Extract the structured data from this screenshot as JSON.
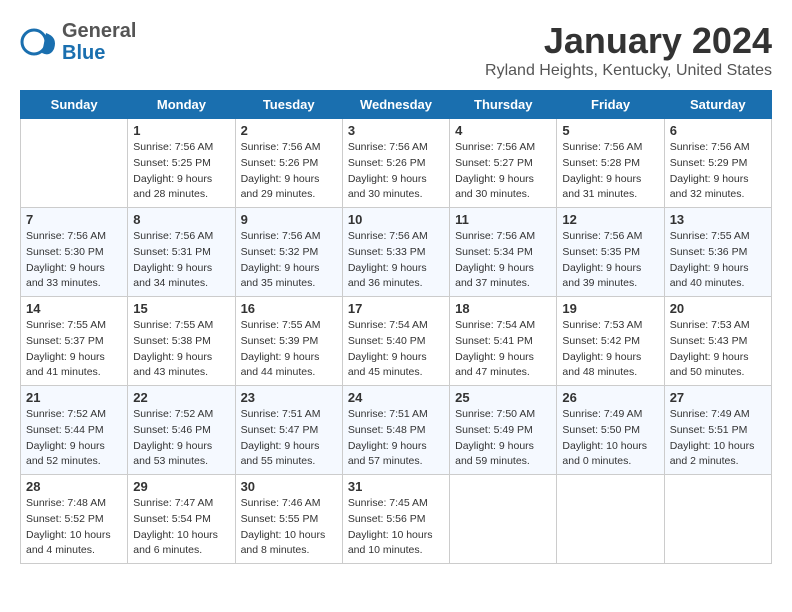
{
  "header": {
    "logo_line1": "General",
    "logo_line2": "Blue",
    "month_year": "January 2024",
    "location": "Ryland Heights, Kentucky, United States"
  },
  "days_of_week": [
    "Sunday",
    "Monday",
    "Tuesday",
    "Wednesday",
    "Thursday",
    "Friday",
    "Saturday"
  ],
  "weeks": [
    [
      {
        "day": "",
        "sunrise": "",
        "sunset": "",
        "daylight": ""
      },
      {
        "day": "1",
        "sunrise": "Sunrise: 7:56 AM",
        "sunset": "Sunset: 5:25 PM",
        "daylight": "Daylight: 9 hours and 28 minutes."
      },
      {
        "day": "2",
        "sunrise": "Sunrise: 7:56 AM",
        "sunset": "Sunset: 5:26 PM",
        "daylight": "Daylight: 9 hours and 29 minutes."
      },
      {
        "day": "3",
        "sunrise": "Sunrise: 7:56 AM",
        "sunset": "Sunset: 5:26 PM",
        "daylight": "Daylight: 9 hours and 30 minutes."
      },
      {
        "day": "4",
        "sunrise": "Sunrise: 7:56 AM",
        "sunset": "Sunset: 5:27 PM",
        "daylight": "Daylight: 9 hours and 30 minutes."
      },
      {
        "day": "5",
        "sunrise": "Sunrise: 7:56 AM",
        "sunset": "Sunset: 5:28 PM",
        "daylight": "Daylight: 9 hours and 31 minutes."
      },
      {
        "day": "6",
        "sunrise": "Sunrise: 7:56 AM",
        "sunset": "Sunset: 5:29 PM",
        "daylight": "Daylight: 9 hours and 32 minutes."
      }
    ],
    [
      {
        "day": "7",
        "sunrise": "Sunrise: 7:56 AM",
        "sunset": "Sunset: 5:30 PM",
        "daylight": "Daylight: 9 hours and 33 minutes."
      },
      {
        "day": "8",
        "sunrise": "Sunrise: 7:56 AM",
        "sunset": "Sunset: 5:31 PM",
        "daylight": "Daylight: 9 hours and 34 minutes."
      },
      {
        "day": "9",
        "sunrise": "Sunrise: 7:56 AM",
        "sunset": "Sunset: 5:32 PM",
        "daylight": "Daylight: 9 hours and 35 minutes."
      },
      {
        "day": "10",
        "sunrise": "Sunrise: 7:56 AM",
        "sunset": "Sunset: 5:33 PM",
        "daylight": "Daylight: 9 hours and 36 minutes."
      },
      {
        "day": "11",
        "sunrise": "Sunrise: 7:56 AM",
        "sunset": "Sunset: 5:34 PM",
        "daylight": "Daylight: 9 hours and 37 minutes."
      },
      {
        "day": "12",
        "sunrise": "Sunrise: 7:56 AM",
        "sunset": "Sunset: 5:35 PM",
        "daylight": "Daylight: 9 hours and 39 minutes."
      },
      {
        "day": "13",
        "sunrise": "Sunrise: 7:55 AM",
        "sunset": "Sunset: 5:36 PM",
        "daylight": "Daylight: 9 hours and 40 minutes."
      }
    ],
    [
      {
        "day": "14",
        "sunrise": "Sunrise: 7:55 AM",
        "sunset": "Sunset: 5:37 PM",
        "daylight": "Daylight: 9 hours and 41 minutes."
      },
      {
        "day": "15",
        "sunrise": "Sunrise: 7:55 AM",
        "sunset": "Sunset: 5:38 PM",
        "daylight": "Daylight: 9 hours and 43 minutes."
      },
      {
        "day": "16",
        "sunrise": "Sunrise: 7:55 AM",
        "sunset": "Sunset: 5:39 PM",
        "daylight": "Daylight: 9 hours and 44 minutes."
      },
      {
        "day": "17",
        "sunrise": "Sunrise: 7:54 AM",
        "sunset": "Sunset: 5:40 PM",
        "daylight": "Daylight: 9 hours and 45 minutes."
      },
      {
        "day": "18",
        "sunrise": "Sunrise: 7:54 AM",
        "sunset": "Sunset: 5:41 PM",
        "daylight": "Daylight: 9 hours and 47 minutes."
      },
      {
        "day": "19",
        "sunrise": "Sunrise: 7:53 AM",
        "sunset": "Sunset: 5:42 PM",
        "daylight": "Daylight: 9 hours and 48 minutes."
      },
      {
        "day": "20",
        "sunrise": "Sunrise: 7:53 AM",
        "sunset": "Sunset: 5:43 PM",
        "daylight": "Daylight: 9 hours and 50 minutes."
      }
    ],
    [
      {
        "day": "21",
        "sunrise": "Sunrise: 7:52 AM",
        "sunset": "Sunset: 5:44 PM",
        "daylight": "Daylight: 9 hours and 52 minutes."
      },
      {
        "day": "22",
        "sunrise": "Sunrise: 7:52 AM",
        "sunset": "Sunset: 5:46 PM",
        "daylight": "Daylight: 9 hours and 53 minutes."
      },
      {
        "day": "23",
        "sunrise": "Sunrise: 7:51 AM",
        "sunset": "Sunset: 5:47 PM",
        "daylight": "Daylight: 9 hours and 55 minutes."
      },
      {
        "day": "24",
        "sunrise": "Sunrise: 7:51 AM",
        "sunset": "Sunset: 5:48 PM",
        "daylight": "Daylight: 9 hours and 57 minutes."
      },
      {
        "day": "25",
        "sunrise": "Sunrise: 7:50 AM",
        "sunset": "Sunset: 5:49 PM",
        "daylight": "Daylight: 9 hours and 59 minutes."
      },
      {
        "day": "26",
        "sunrise": "Sunrise: 7:49 AM",
        "sunset": "Sunset: 5:50 PM",
        "daylight": "Daylight: 10 hours and 0 minutes."
      },
      {
        "day": "27",
        "sunrise": "Sunrise: 7:49 AM",
        "sunset": "Sunset: 5:51 PM",
        "daylight": "Daylight: 10 hours and 2 minutes."
      }
    ],
    [
      {
        "day": "28",
        "sunrise": "Sunrise: 7:48 AM",
        "sunset": "Sunset: 5:52 PM",
        "daylight": "Daylight: 10 hours and 4 minutes."
      },
      {
        "day": "29",
        "sunrise": "Sunrise: 7:47 AM",
        "sunset": "Sunset: 5:54 PM",
        "daylight": "Daylight: 10 hours and 6 minutes."
      },
      {
        "day": "30",
        "sunrise": "Sunrise: 7:46 AM",
        "sunset": "Sunset: 5:55 PM",
        "daylight": "Daylight: 10 hours and 8 minutes."
      },
      {
        "day": "31",
        "sunrise": "Sunrise: 7:45 AM",
        "sunset": "Sunset: 5:56 PM",
        "daylight": "Daylight: 10 hours and 10 minutes."
      },
      {
        "day": "",
        "sunrise": "",
        "sunset": "",
        "daylight": ""
      },
      {
        "day": "",
        "sunrise": "",
        "sunset": "",
        "daylight": ""
      },
      {
        "day": "",
        "sunrise": "",
        "sunset": "",
        "daylight": ""
      }
    ]
  ]
}
